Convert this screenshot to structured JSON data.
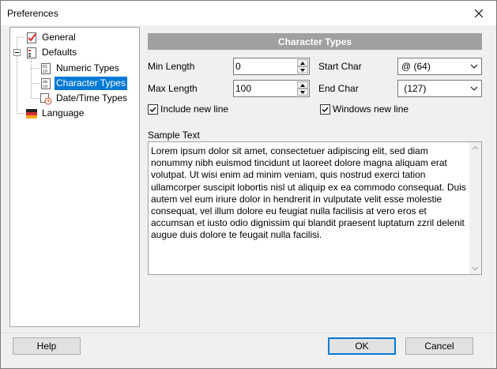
{
  "window": {
    "title": "Preferences"
  },
  "tree": {
    "items": [
      {
        "label": "General",
        "icon": "general-page-icon"
      },
      {
        "label": "Defaults",
        "icon": "defaults-folder-icon"
      },
      {
        "label": "Numeric Types",
        "icon": "numeric-types-icon"
      },
      {
        "label": "Character Types",
        "icon": "character-types-icon",
        "selected": true
      },
      {
        "label": "Date/Time Types",
        "icon": "datetime-types-icon"
      },
      {
        "label": "Language",
        "icon": "language-flag-icon"
      }
    ]
  },
  "panel": {
    "header": "Character Types",
    "min_length": {
      "label": "Min Length",
      "value": "0"
    },
    "max_length": {
      "label": "Max Length",
      "value": "100"
    },
    "start_char": {
      "label": "Start Char",
      "value": "@ (64)"
    },
    "end_char": {
      "label": "End Char",
      "value": " (127)"
    },
    "include_new_line": {
      "label": "Include new line",
      "checked": true
    },
    "windows_new_line": {
      "label": "Windows new line",
      "checked": true
    },
    "sample_text_label": "Sample Text",
    "sample_text": "Lorem ipsum dolor sit amet, consectetuer adipiscing elit, sed diam nonummy nibh euismod tincidunt ut laoreet dolore magna aliquam erat volutpat. Ut wisi enim ad minim veniam, quis nostrud exerci tation ullamcorper suscipit lobortis nisl ut aliquip ex ea commodo consequat. Duis autem vel eum iriure dolor in hendrerit in vulputate velit esse molestie consequat, vel illum dolore eu feugiat nulla facilisis at vero eros et accumsan et iusto odio dignissim qui blandit praesent luptatum zzril delenit augue duis dolore te feugait nulla facilisi."
  },
  "footer": {
    "help": "Help",
    "ok": "OK",
    "cancel": "Cancel"
  },
  "colors": {
    "selection": "#0078d7",
    "header_bar": "#a0a0a0",
    "default_button_border": "#0078d7"
  }
}
